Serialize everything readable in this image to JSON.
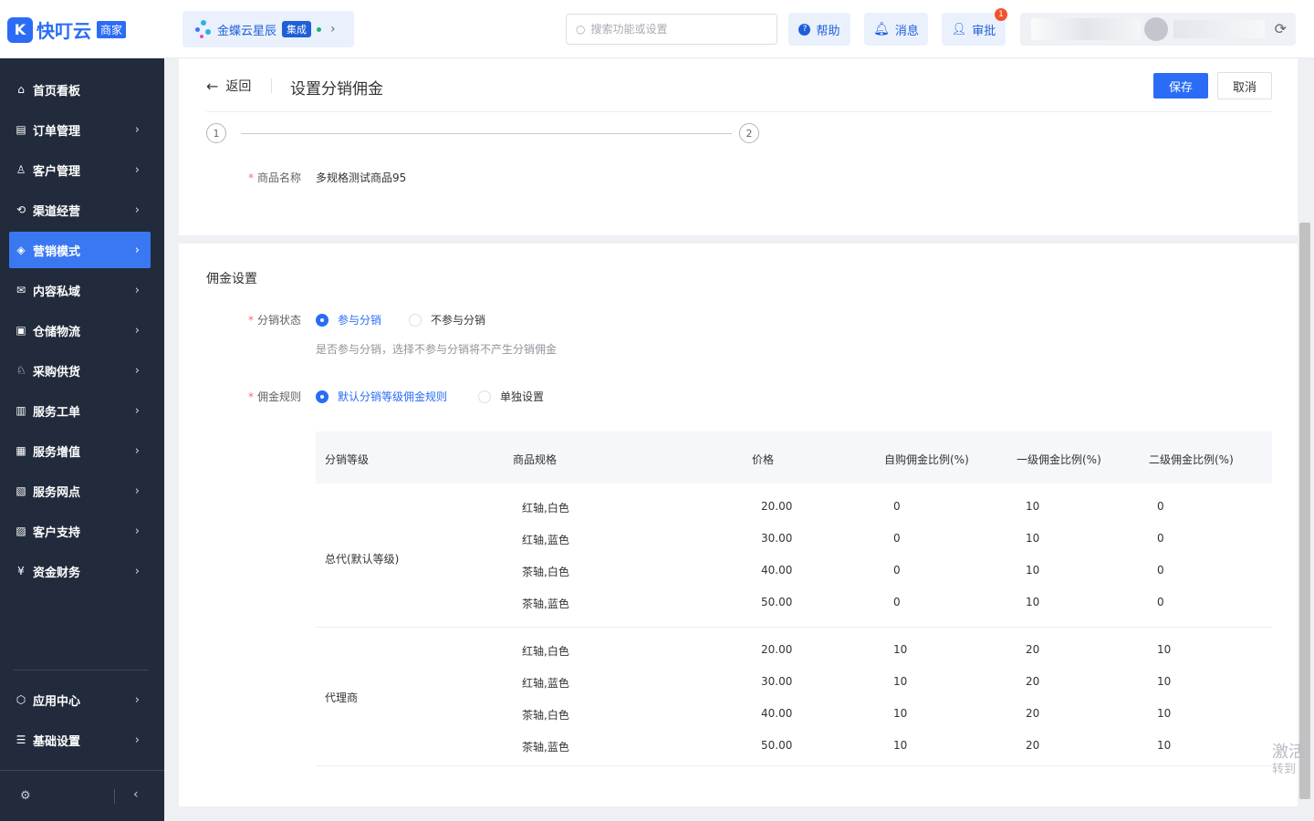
{
  "header": {
    "logo_mark": "K",
    "logo_text": "快叮云",
    "logo_tag": "商家",
    "brand_name": "金蝶云星辰",
    "brand_badge": "集成",
    "search_placeholder": "搜索功能或设置",
    "help_label": "帮助",
    "messages_label": "消息",
    "approval_label": "审批",
    "approval_count": "1"
  },
  "sidebar": {
    "items": [
      {
        "label": "首页看板",
        "icon": "home-icon",
        "glyph": "⌂"
      },
      {
        "label": "订单管理",
        "icon": "clipboard-icon",
        "glyph": "▤"
      },
      {
        "label": "客户管理",
        "icon": "user-icon",
        "glyph": "♙"
      },
      {
        "label": "渠道经营",
        "icon": "network-icon",
        "glyph": "⟲"
      },
      {
        "label": "营销模式",
        "icon": "tag-icon",
        "glyph": "◈"
      },
      {
        "label": "内容私域",
        "icon": "mail-icon",
        "glyph": "✉"
      },
      {
        "label": "仓储物流",
        "icon": "calendar-icon",
        "glyph": "▣"
      },
      {
        "label": "采购供货",
        "icon": "person-icon",
        "glyph": "♘"
      },
      {
        "label": "服务工单",
        "icon": "document-icon",
        "glyph": "▥"
      },
      {
        "label": "服务增值",
        "icon": "bag-icon",
        "glyph": "▦"
      },
      {
        "label": "服务网点",
        "icon": "store-icon",
        "glyph": "▧"
      },
      {
        "label": "客户支持",
        "icon": "chat-icon",
        "glyph": "▨"
      },
      {
        "label": "资金财务",
        "icon": "yen-icon",
        "glyph": "¥"
      }
    ],
    "bottom_items": [
      {
        "label": "应用中心",
        "icon": "cube-icon",
        "glyph": "⬡"
      },
      {
        "label": "基础设置",
        "icon": "sliders-icon",
        "glyph": "☰"
      }
    ]
  },
  "page": {
    "back_label": "返回",
    "title": "设置分销佣金",
    "save_label": "保存",
    "cancel_label": "取消",
    "steps": [
      "1",
      "2"
    ],
    "product_name_label": "商品名称",
    "product_name": "多规格测试商品95"
  },
  "commission": {
    "section_title": "佣金设置",
    "status_label": "分销状态",
    "status_options": [
      "参与分销",
      "不参与分销"
    ],
    "status_selected": "参与分销",
    "status_hint": "是否参与分销，选择不参与分销将不产生分销佣金",
    "rule_label": "佣金规则",
    "rule_options": [
      "默认分销等级佣金规则",
      "单独设置"
    ],
    "rule_selected": "默认分销等级佣金规则"
  },
  "table": {
    "headers": [
      "分销等级",
      "商品规格",
      "价格",
      "自购佣金比例(%)",
      "一级佣金比例(%)",
      "二级佣金比例(%)"
    ],
    "groups": [
      {
        "level": "总代(默认等级)",
        "rows": [
          [
            "红轴,白色",
            "20.00",
            "0",
            "10",
            "0"
          ],
          [
            "红轴,蓝色",
            "30.00",
            "0",
            "10",
            "0"
          ],
          [
            "茶轴,白色",
            "40.00",
            "0",
            "10",
            "0"
          ],
          [
            "茶轴,蓝色",
            "50.00",
            "0",
            "10",
            "0"
          ]
        ]
      },
      {
        "level": "代理商",
        "rows": [
          [
            "红轴,白色",
            "20.00",
            "10",
            "20",
            "10"
          ],
          [
            "红轴,蓝色",
            "30.00",
            "10",
            "20",
            "10"
          ],
          [
            "茶轴,白色",
            "40.00",
            "10",
            "20",
            "10"
          ],
          [
            "茶轴,蓝色",
            "50.00",
            "10",
            "20",
            "10"
          ]
        ]
      }
    ]
  },
  "watermark": {
    "line1": "激活",
    "line2": "转到"
  }
}
